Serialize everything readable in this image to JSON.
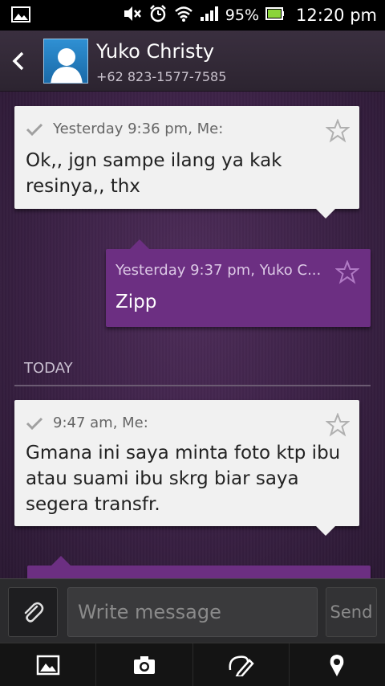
{
  "status_bar": {
    "battery": "95%",
    "time": "12:20 pm"
  },
  "header": {
    "contact_name": "Yuko Christy",
    "contact_number": "+62 823-1577-7585"
  },
  "messages": [
    {
      "direction": "outgoing",
      "meta": "Yesterday 9:36 pm, Me:",
      "lines": [
        "Ok,, jgn sampe ilang ya kak",
        "resinya,, thx"
      ]
    },
    {
      "direction": "incoming",
      "meta": "Yesterday 9:37 pm, Yuko C...",
      "lines": [
        "Zipp"
      ]
    },
    {
      "direction": "outgoing",
      "meta": "9:47 am, Me:",
      "lines": [
        "Gmana ini saya minta foto ktp ibu",
        "atau suami ibu skrg biar saya",
        "segera transfr."
      ]
    }
  ],
  "divider": {
    "label": "TODAY"
  },
  "composer": {
    "placeholder": "Write message",
    "send_label": "Send"
  },
  "toolbar": {
    "items": [
      "image-icon",
      "camera-icon",
      "sketch-icon",
      "location-icon"
    ]
  },
  "colors": {
    "incoming_bubble": "#6c2f82",
    "outgoing_bubble": "#f1f1f1",
    "background": "#3a2144"
  }
}
